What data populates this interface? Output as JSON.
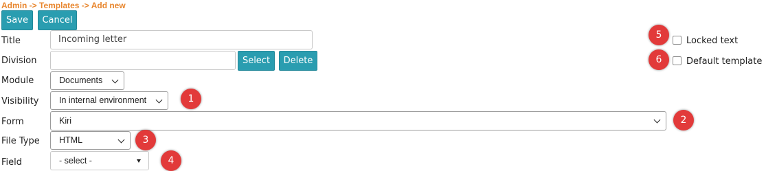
{
  "breadcrumb": "Admin -> Templates -> Add new",
  "toolbar": {
    "save_label": "Save",
    "cancel_label": "Cancel"
  },
  "fields": {
    "title": {
      "label": "Title",
      "value": "Incoming letter"
    },
    "division": {
      "label": "Division",
      "value": "",
      "select_label": "Select",
      "delete_label": "Delete"
    },
    "module": {
      "label": "Module",
      "value": "Documents"
    },
    "visibility": {
      "label": "Visibility",
      "value": "In internal environment"
    },
    "form": {
      "label": "Form",
      "value": "Kiri"
    },
    "file_type": {
      "label": "File Type",
      "value": "HTML"
    },
    "field": {
      "label": "Field",
      "value": "- select -"
    }
  },
  "options": {
    "locked_text": {
      "label": "Locked text",
      "checked": false
    },
    "default_template": {
      "label": "Default template",
      "checked": false
    }
  },
  "badges": [
    "1",
    "2",
    "3",
    "4",
    "5",
    "6"
  ],
  "colors": {
    "accent": "#2a9db0",
    "breadcrumb": "#e8862e",
    "badge": "#e23a3a"
  }
}
